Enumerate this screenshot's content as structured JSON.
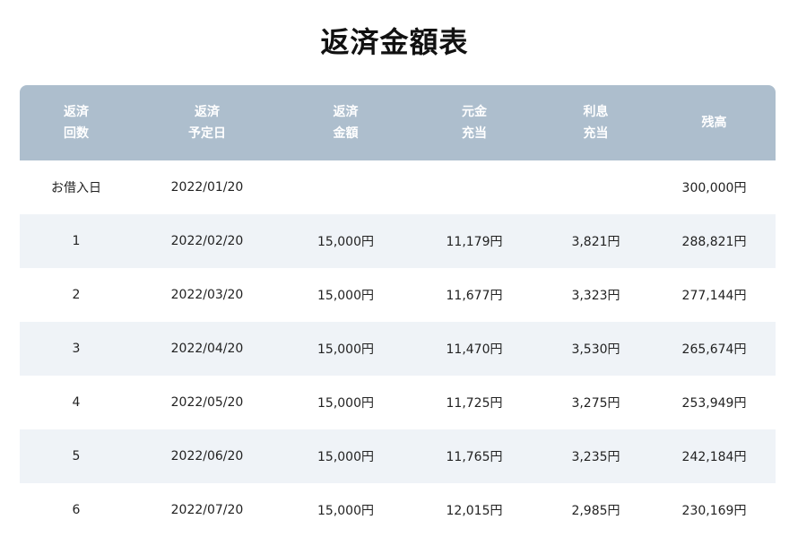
{
  "title": "返済金額表",
  "table": {
    "headers": [
      [
        "返済",
        "回数"
      ],
      [
        "返済",
        "予定日"
      ],
      [
        "返済",
        "金額"
      ],
      [
        "元金",
        "充当"
      ],
      [
        "利息",
        "充当"
      ],
      [
        "残高"
      ]
    ],
    "rows": [
      [
        "お借入日",
        "2022/01/20",
        "",
        "",
        "",
        "300,000円"
      ],
      [
        "1",
        "2022/02/20",
        "15,000円",
        "11,179円",
        "3,821円",
        "288,821円"
      ],
      [
        "2",
        "2022/03/20",
        "15,000円",
        "11,677円",
        "3,323円",
        "277,144円"
      ],
      [
        "3",
        "2022/04/20",
        "15,000円",
        "11,470円",
        "3,530円",
        "265,674円"
      ],
      [
        "4",
        "2022/05/20",
        "15,000円",
        "11,725円",
        "3,275円",
        "253,949円"
      ],
      [
        "5",
        "2022/06/20",
        "15,000円",
        "11,765円",
        "3,235円",
        "242,184円"
      ],
      [
        "6",
        "2022/07/20",
        "15,000円",
        "12,015円",
        "2,985円",
        "230,169円"
      ]
    ]
  },
  "colors": {
    "header_bg": "#adbecd",
    "header_text": "#ffffff",
    "stripe_bg": "#eff3f7"
  }
}
